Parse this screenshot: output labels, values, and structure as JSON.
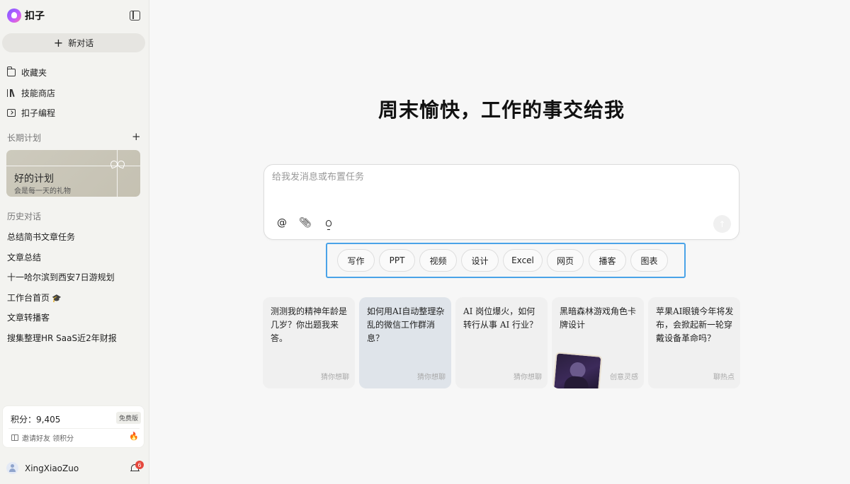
{
  "brand": {
    "name": "扣子"
  },
  "sidebar": {
    "new_chat_label": "新对话",
    "nav": [
      {
        "label": "收藏夹",
        "icon": "folder-icon"
      },
      {
        "label": "技能商店",
        "icon": "library-icon"
      },
      {
        "label": "扣子编程",
        "icon": "code-icon"
      }
    ],
    "long_term_label": "长期计划",
    "plan_card": {
      "title": "好的计划",
      "subtitle": "会是每一天的礼物"
    },
    "history_label": "历史对话",
    "history": [
      "总结简书文章任务",
      "文章总结",
      "十一哈尔滨到西安7日游规划",
      "工作台首页",
      "文章转播客",
      "搜集整理HR SaaS近2年财报"
    ],
    "points": {
      "text": "积分：9,405",
      "badge": "免费版",
      "invite": "邀请好友 领积分"
    },
    "user": {
      "name": "XingXiaoZuo",
      "notifications": "6"
    }
  },
  "main": {
    "headline": "周末愉快，工作的事交给我",
    "composer": {
      "placeholder": "给我发消息或布置任务"
    },
    "chips": [
      "写作",
      "PPT",
      "视频",
      "设计",
      "Excel",
      "网页",
      "播客",
      "图表"
    ],
    "suggestions": [
      {
        "text": "测测我的精神年龄是几岁？你出题我来答。",
        "tag": "猜你想聊"
      },
      {
        "text": "如何用AI自动整理杂乱的微信工作群消息？",
        "tag": "猜你想聊"
      },
      {
        "text": "AI 岗位爆火，如何转行从事 AI 行业？",
        "tag": "猜你想聊"
      },
      {
        "text": "黑暗森林游戏角色卡牌设计",
        "tag": "创意灵感"
      },
      {
        "text": "苹果AI眼镜今年将发布，会掀起新一轮穿戴设备革命吗？",
        "tag": "聊热点"
      }
    ]
  }
}
